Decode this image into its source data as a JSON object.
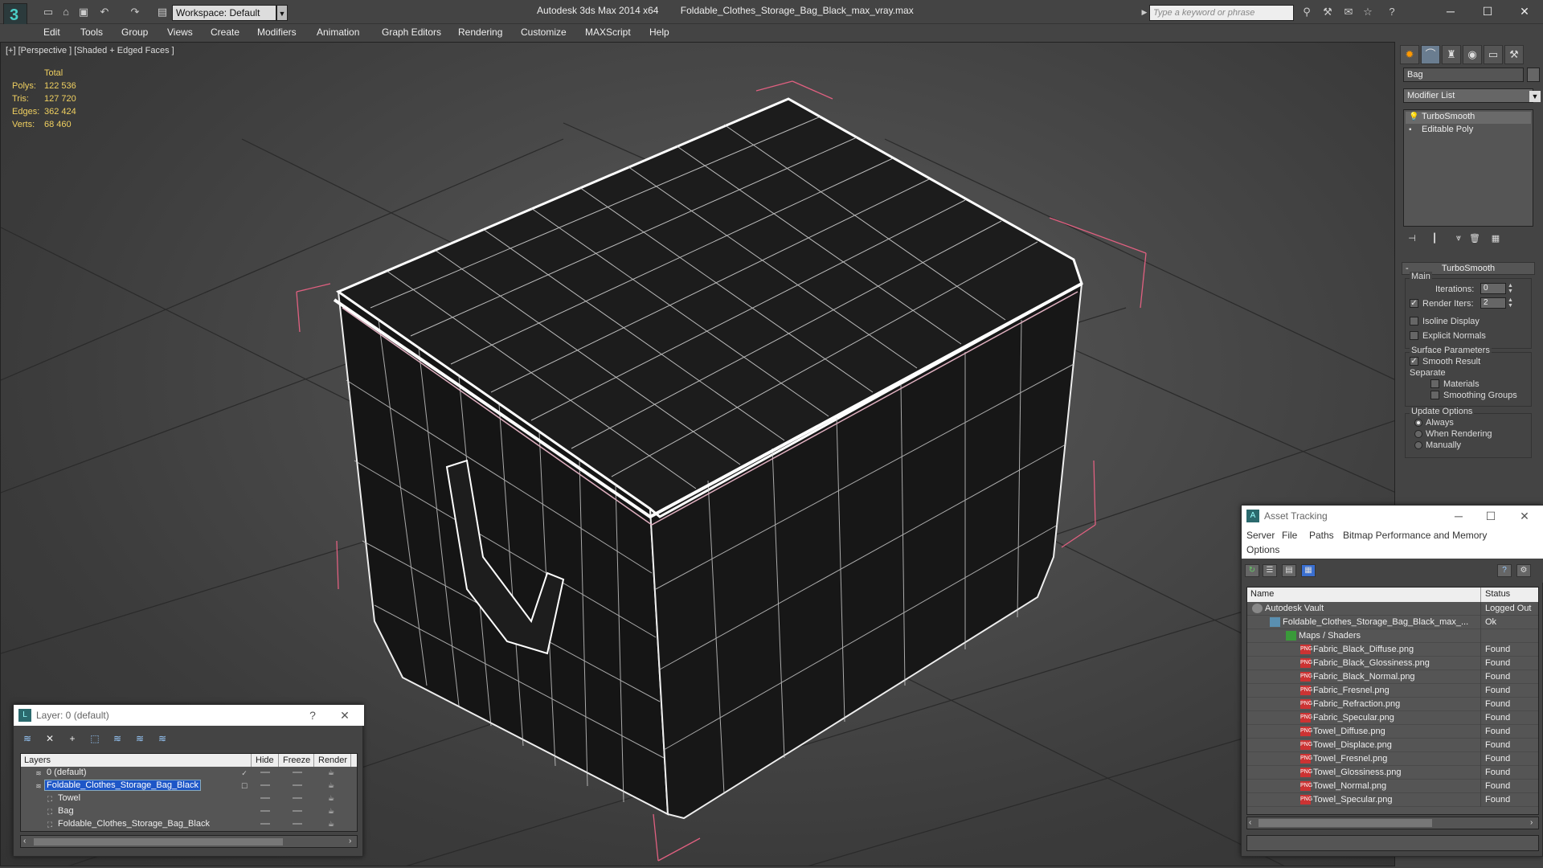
{
  "titlebar": {
    "workspace": "Workspace: Default",
    "app_name": "Autodesk 3ds Max  2014 x64",
    "file_name": "Foldable_Clothes_Storage_Bag_Black_max_vray.max",
    "search_placeholder": "Type a keyword or phrase"
  },
  "menubar": {
    "items": [
      "Edit",
      "Tools",
      "Group",
      "Views",
      "Create",
      "Modifiers",
      "Animation",
      "Graph Editors",
      "Rendering",
      "Customize",
      "MAXScript",
      "Help"
    ]
  },
  "viewport": {
    "label": "[+] [Perspective ] [Shaded + Edged Faces ]",
    "stats": {
      "header": "Total",
      "rows": [
        {
          "key": "Polys:",
          "value": "122 536"
        },
        {
          "key": "Tris:",
          "value": "127 720"
        },
        {
          "key": "Edges:",
          "value": "362 424"
        },
        {
          "key": "Verts:",
          "value": "68 460"
        }
      ]
    }
  },
  "command_panel": {
    "object_name": "Bag",
    "modifier_list": "Modifier List",
    "stack": [
      "TurboSmooth",
      "Editable Poly"
    ],
    "rollout_title": "TurboSmooth",
    "main_group": "Main",
    "iterations_label": "Iterations:",
    "iterations_value": "0",
    "render_iters_label": "Render Iters:",
    "render_iters_value": "2",
    "render_iters_checked": true,
    "isoline_label": "Isoline Display",
    "explicit_normals_label": "Explicit Normals",
    "surface_group": "Surface Parameters",
    "smooth_result_label": "Smooth Result",
    "separate_label": "Separate",
    "materials_label": "Materials",
    "smoothing_groups_label": "Smoothing Groups",
    "update_group": "Update Options",
    "update_options": [
      "Always",
      "When Rendering",
      "Manually"
    ],
    "update_selected": 0
  },
  "asset_tracking": {
    "title": "Asset Tracking",
    "menu": [
      "Server",
      "File",
      "Paths",
      "Bitmap Performance and Memory",
      "Options"
    ],
    "columns": [
      "Name",
      "Status"
    ],
    "rows": [
      {
        "name": "Autodesk Vault",
        "status": "Logged Out",
        "indent": 0,
        "icon": "vault"
      },
      {
        "name": "Foldable_Clothes_Storage_Bag_Black_max_...",
        "status": "Ok",
        "indent": 1,
        "icon": "max"
      },
      {
        "name": "Maps / Shaders",
        "status": "",
        "indent": 2,
        "icon": "maps"
      },
      {
        "name": "Fabric_Black_Diffuse.png",
        "status": "Found",
        "indent": 3,
        "icon": "png"
      },
      {
        "name": "Fabric_Black_Glossiness.png",
        "status": "Found",
        "indent": 3,
        "icon": "png"
      },
      {
        "name": "Fabric_Black_Normal.png",
        "status": "Found",
        "indent": 3,
        "icon": "png"
      },
      {
        "name": "Fabric_Fresnel.png",
        "status": "Found",
        "indent": 3,
        "icon": "png"
      },
      {
        "name": "Fabric_Refraction.png",
        "status": "Found",
        "indent": 3,
        "icon": "png"
      },
      {
        "name": "Fabric_Specular.png",
        "status": "Found",
        "indent": 3,
        "icon": "png"
      },
      {
        "name": "Towel_Diffuse.png",
        "status": "Found",
        "indent": 3,
        "icon": "png"
      },
      {
        "name": "Towel_Displace.png",
        "status": "Found",
        "indent": 3,
        "icon": "png"
      },
      {
        "name": "Towel_Fresnel.png",
        "status": "Found",
        "indent": 3,
        "icon": "png"
      },
      {
        "name": "Towel_Glossiness.png",
        "status": "Found",
        "indent": 3,
        "icon": "png"
      },
      {
        "name": "Towel_Normal.png",
        "status": "Found",
        "indent": 3,
        "icon": "png"
      },
      {
        "name": "Towel_Specular.png",
        "status": "Found",
        "indent": 3,
        "icon": "png"
      }
    ]
  },
  "layers": {
    "title": "Layer: 0 (default)",
    "help": "?",
    "columns": [
      "Layers",
      "Hide",
      "Freeze",
      "Render"
    ],
    "rows": [
      {
        "name": "0 (default)",
        "indent": 0,
        "selected": false
      },
      {
        "name": "Foldable_Clothes_Storage_Bag_Black",
        "indent": 0,
        "selected": true
      },
      {
        "name": "Towel",
        "indent": 1,
        "selected": false
      },
      {
        "name": "Bag",
        "indent": 1,
        "selected": false
      },
      {
        "name": "Foldable_Clothes_Storage_Bag_Black",
        "indent": 1,
        "selected": false
      }
    ]
  }
}
